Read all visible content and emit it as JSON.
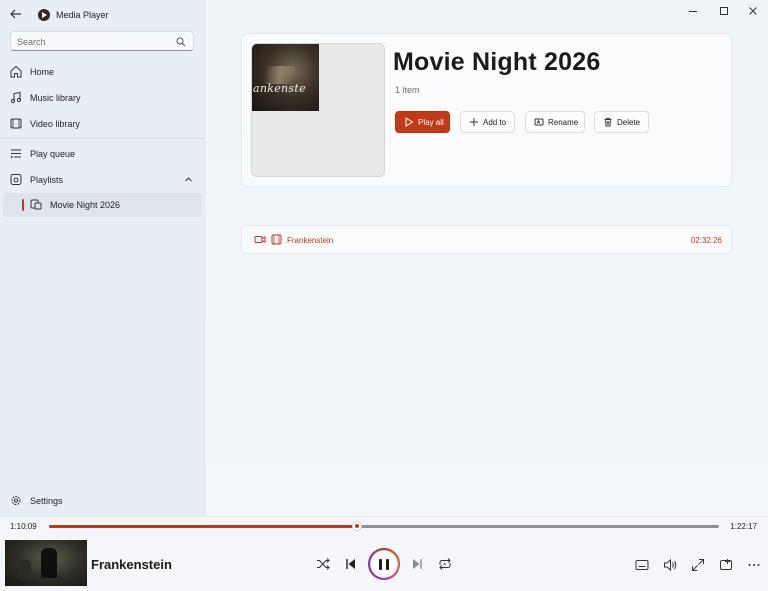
{
  "app": {
    "title": "Media Player"
  },
  "search": {
    "placeholder": "Search"
  },
  "sidebar": {
    "items": [
      {
        "label": "Home",
        "icon": "home-icon"
      },
      {
        "label": "Music library",
        "icon": "music-note-icon"
      },
      {
        "label": "Video library",
        "icon": "video-icon"
      },
      {
        "label": "Play queue",
        "icon": "queue-icon"
      },
      {
        "label": "Playlists",
        "icon": "playlist-icon"
      },
      {
        "label": "Movie Night 2026",
        "icon": "playlist-item-icon",
        "selected": true
      }
    ],
    "settings_label": "Settings"
  },
  "playlist": {
    "title": "Movie Night 2026",
    "count": "1 item",
    "cover_text": "ankenste",
    "buttons": {
      "play_all": "Play all",
      "add_to": "Add to",
      "rename": "Rename",
      "delete": "Delete"
    },
    "tracks": [
      {
        "name": "Frankenstein",
        "duration": "02:32:26"
      }
    ]
  },
  "player": {
    "current_time": "1:10:09",
    "total_time": "1:22:17",
    "progress": 0.46,
    "now_playing": "Frankenstein"
  },
  "colors": {
    "accent": "#c13a17",
    "sidebar_bg": "#e8eef5",
    "main_bg": "#eff4f9"
  }
}
